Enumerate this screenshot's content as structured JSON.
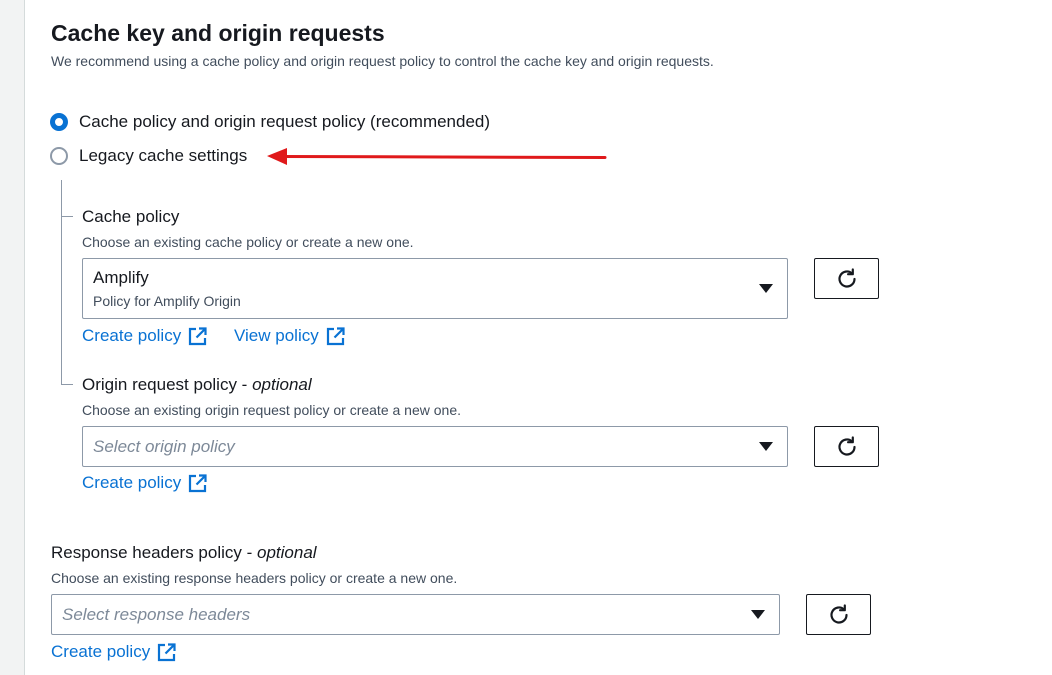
{
  "section": {
    "title": "Cache key and origin requests",
    "description": "We recommend using a cache policy and origin request policy to control the cache key and origin requests."
  },
  "radio_options": [
    {
      "label": "Cache policy and origin request policy (recommended)",
      "selected": true
    },
    {
      "label": "Legacy cache settings",
      "selected": false
    }
  ],
  "annotation": {
    "arrow_color": "#e0191b"
  },
  "cache_policy": {
    "label": "Cache policy",
    "description": "Choose an existing cache policy or create a new one.",
    "selected_value": "Amplify",
    "selected_description": "Policy for Amplify Origin",
    "create_link": "Create policy",
    "view_link": "View policy"
  },
  "origin_request_policy": {
    "label": "Origin request policy - ",
    "optional": "optional",
    "description": "Choose an existing origin request policy or create a new one.",
    "placeholder": "Select origin policy",
    "create_link": "Create policy"
  },
  "response_headers_policy": {
    "label": "Response headers policy - ",
    "optional": "optional",
    "description": "Choose an existing response headers policy or create a new one.",
    "placeholder": "Select response headers",
    "create_link": "Create policy"
  },
  "icons": {
    "refresh": "refresh-icon",
    "external": "external-link-icon",
    "caret": "caret-down-icon"
  },
  "colors": {
    "link": "#0972d3",
    "radio_selected": "#0972d3",
    "text": "#16191f",
    "muted": "#414d5c"
  }
}
